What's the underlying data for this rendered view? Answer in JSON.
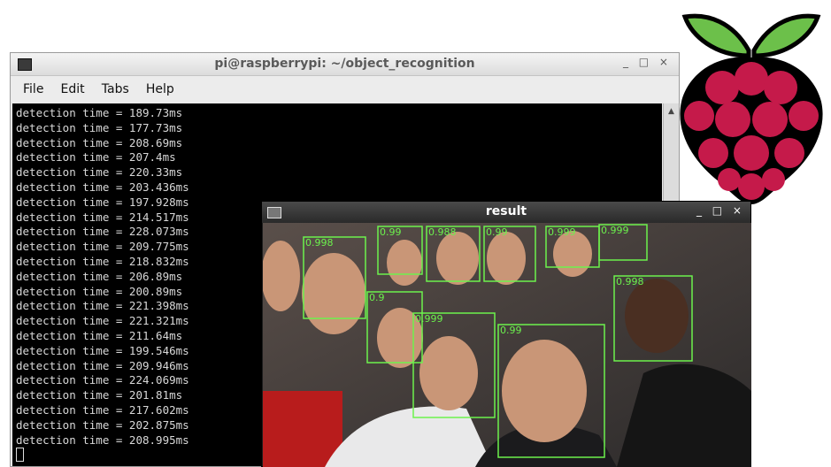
{
  "terminal": {
    "title": "pi@raspberrypi: ~/object_recognition",
    "controls": "_ □ ×",
    "menu": [
      "File",
      "Edit",
      "Tabs",
      "Help"
    ],
    "lines": [
      "detection time = 189.73ms",
      "detection time = 177.73ms",
      "detection time = 208.69ms",
      "detection time = 207.4ms",
      "detection time = 220.33ms",
      "detection time = 203.436ms",
      "detection time = 197.928ms",
      "detection time = 214.517ms",
      "detection time = 228.073ms",
      "detection time = 209.775ms",
      "detection time = 218.832ms",
      "detection time = 206.89ms",
      "detection time = 200.89ms",
      "detection time = 221.398ms",
      "detection time = 221.321ms",
      "detection time = 211.64ms",
      "detection time = 199.546ms",
      "detection time = 209.946ms",
      "detection time = 224.069ms",
      "detection time = 201.81ms",
      "detection time = 217.602ms",
      "detection time = 202.875ms",
      "detection time = 208.995ms"
    ]
  },
  "result_window": {
    "title": "result",
    "controls": "_ □ ×",
    "detections": [
      {
        "label": "0.998"
      },
      {
        "label": "0.9"
      },
      {
        "label": "0.999"
      },
      {
        "label": "0.99"
      },
      {
        "label": "0.988"
      },
      {
        "label": "0.99"
      },
      {
        "label": "0.99"
      },
      {
        "label": "0.999"
      },
      {
        "label": "0.998"
      },
      {
        "label": "0.999"
      }
    ]
  },
  "colors": {
    "terminal_bg": "#000000",
    "terminal_text": "#d8d8d8",
    "detection_box": "#6cf24d",
    "berry": "#c51a4a",
    "leaf": "#6cc04a"
  },
  "logo": {
    "name": "raspberry-pi-logo"
  }
}
